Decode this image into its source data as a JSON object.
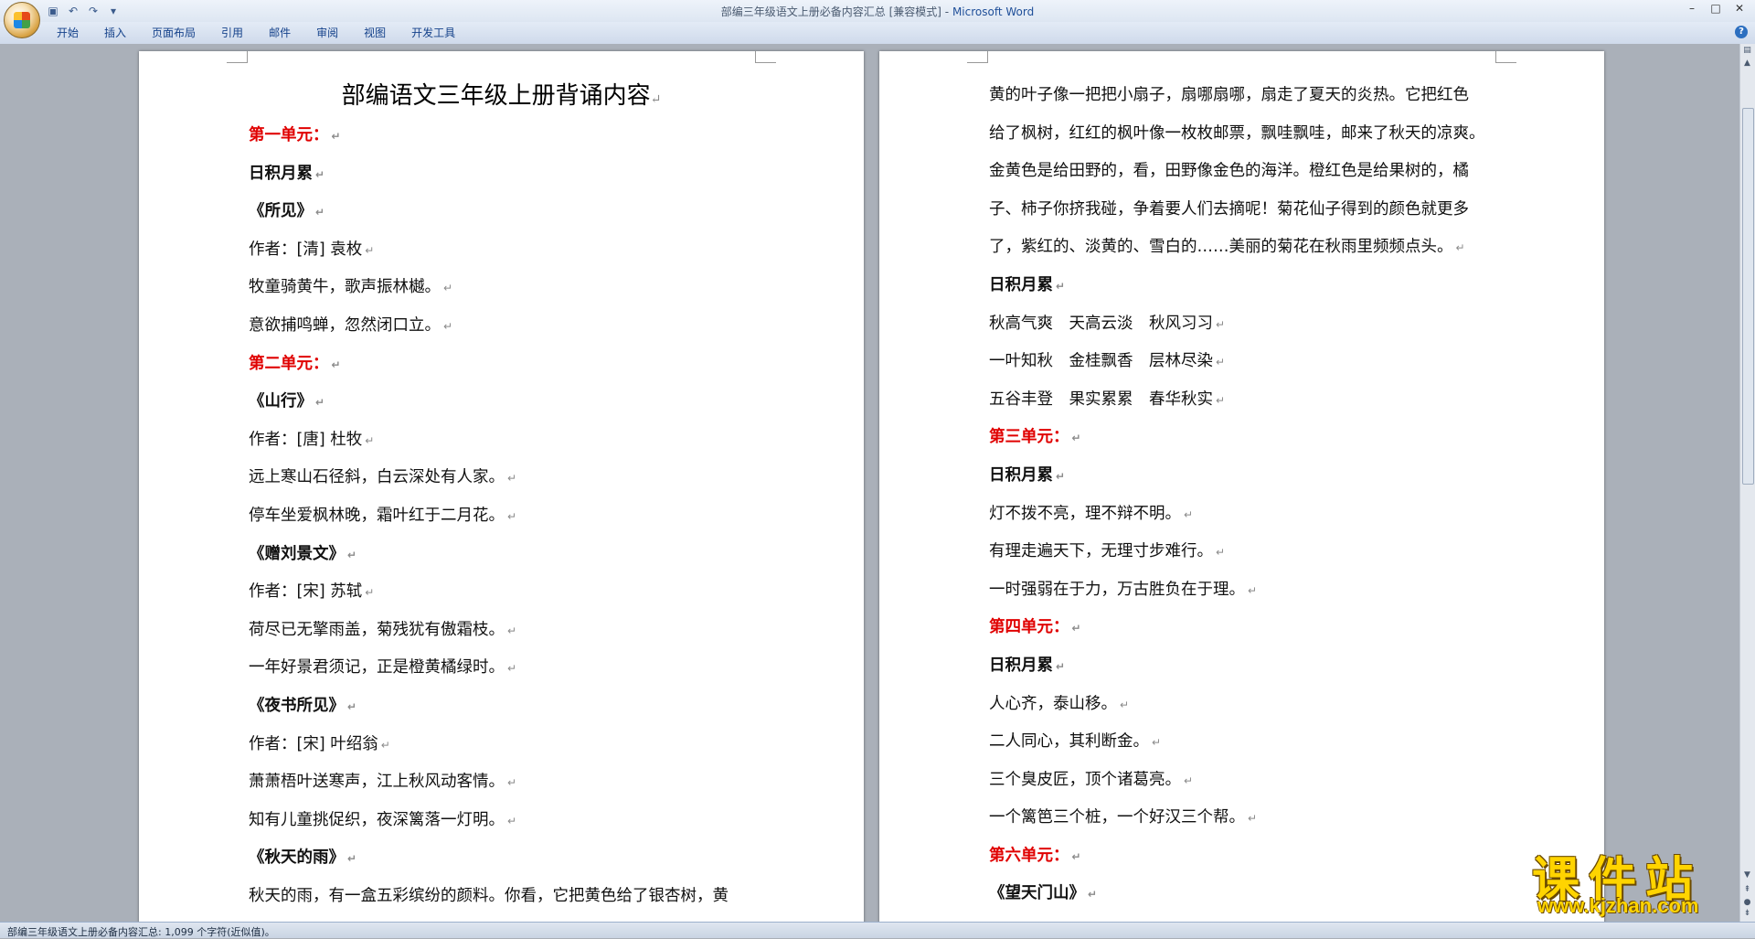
{
  "window": {
    "title": "部编三年级语文上册必备内容汇总 [兼容模式]",
    "app_name": "Microsoft Word",
    "controls": [
      "–",
      "□",
      "✕"
    ]
  },
  "qat": {
    "save_icon": "save-icon",
    "undo_icon": "undo-icon",
    "redo_icon": "redo-icon",
    "customize_icon": "customize-qat-icon"
  },
  "ribbon": {
    "tabs": [
      "开始",
      "插入",
      "页面布局",
      "引用",
      "邮件",
      "审阅",
      "视图",
      "开发工具"
    ],
    "help": "?"
  },
  "document": {
    "title": "部编语文三年级上册背诵内容",
    "page1_lines": [
      {
        "text": "第一单元：",
        "style": "red"
      },
      {
        "text": "日积月累",
        "style": "bold"
      },
      {
        "text": "《所见》",
        "style": "bold"
      },
      {
        "text": "作者：[清] 袁枚",
        "style": "normal"
      },
      {
        "text": "牧童骑黄牛，歌声振林樾。",
        "style": "normal"
      },
      {
        "text": "意欲捕鸣蝉，忽然闭口立。",
        "style": "normal"
      },
      {
        "text": "第二单元：",
        "style": "red"
      },
      {
        "text": "《山行》",
        "style": "bold"
      },
      {
        "text": "作者：[唐] 杜牧",
        "style": "normal"
      },
      {
        "text": "远上寒山石径斜，白云深处有人家。",
        "style": "normal"
      },
      {
        "text": "停车坐爱枫林晚，霜叶红于二月花。",
        "style": "normal"
      },
      {
        "text": "《赠刘景文》",
        "style": "bold"
      },
      {
        "text": "作者：[宋] 苏轼",
        "style": "normal"
      },
      {
        "text": "荷尽已无擎雨盖，菊残犹有傲霜枝。",
        "style": "normal"
      },
      {
        "text": "一年好景君须记，正是橙黄橘绿时。",
        "style": "normal"
      },
      {
        "text": "《夜书所见》",
        "style": "bold"
      },
      {
        "text": "作者：[宋] 叶绍翁",
        "style": "normal"
      },
      {
        "text": "萧萧梧叶送寒声，江上秋风动客情。",
        "style": "normal"
      },
      {
        "text": "知有儿童挑促织，夜深篱落一灯明。",
        "style": "normal"
      },
      {
        "text": "《秋天的雨》",
        "style": "bold"
      },
      {
        "text": "秋天的雨，有一盒五彩缤纷的颜料。你看，它把黄色给了银杏树，黄",
        "style": "normal",
        "no_mark": true
      }
    ],
    "page2_lines": [
      {
        "text": "黄的叶子像一把把小扇子，扇哪扇哪，扇走了夏天的炎热。它把红色",
        "style": "normal",
        "no_mark": true
      },
      {
        "text": "给了枫树，红红的枫叶像一枚枚邮票，飘哇飘哇，邮来了秋天的凉爽。",
        "style": "normal",
        "no_mark": true
      },
      {
        "text": "金黄色是给田野的，看，田野像金色的海洋。橙红色是给果树的，橘",
        "style": "normal",
        "no_mark": true
      },
      {
        "text": "子、柿子你挤我碰，争着要人们去摘呢！菊花仙子得到的颜色就更多",
        "style": "normal",
        "no_mark": true
      },
      {
        "text": "了，紫红的、淡黄的、雪白的……美丽的菊花在秋雨里频频点头。",
        "style": "normal"
      },
      {
        "text": "日积月累",
        "style": "bold"
      },
      {
        "text": "秋高气爽　天高云淡　秋风习习",
        "style": "normal"
      },
      {
        "text": "一叶知秋　金桂飘香　层林尽染",
        "style": "normal"
      },
      {
        "text": "五谷丰登　果实累累　春华秋实",
        "style": "normal"
      },
      {
        "text": "第三单元：",
        "style": "red"
      },
      {
        "text": "日积月累",
        "style": "bold"
      },
      {
        "text": "灯不拨不亮，理不辩不明。",
        "style": "normal"
      },
      {
        "text": "有理走遍天下，无理寸步难行。",
        "style": "normal"
      },
      {
        "text": "一时强弱在于力，万古胜负在于理。",
        "style": "normal"
      },
      {
        "text": "第四单元：",
        "style": "red"
      },
      {
        "text": "日积月累",
        "style": "bold"
      },
      {
        "text": "人心齐，泰山移。",
        "style": "normal"
      },
      {
        "text": "二人同心，其利断金。",
        "style": "normal"
      },
      {
        "text": "三个臭皮匠，顶个诸葛亮。",
        "style": "normal"
      },
      {
        "text": "一个篱笆三个桩，一个好汉三个帮。",
        "style": "normal"
      },
      {
        "text": "第六单元：",
        "style": "red"
      },
      {
        "text": "《望天门山》",
        "style": "bold"
      }
    ],
    "paragraph_mark": "↵"
  },
  "statusbar": {
    "text": "部编三年级语文上册必备内容汇总: 1,099 个字符(近似值)。"
  },
  "watermark": {
    "main": "课件站",
    "sub": "www.kjzhan.com"
  }
}
